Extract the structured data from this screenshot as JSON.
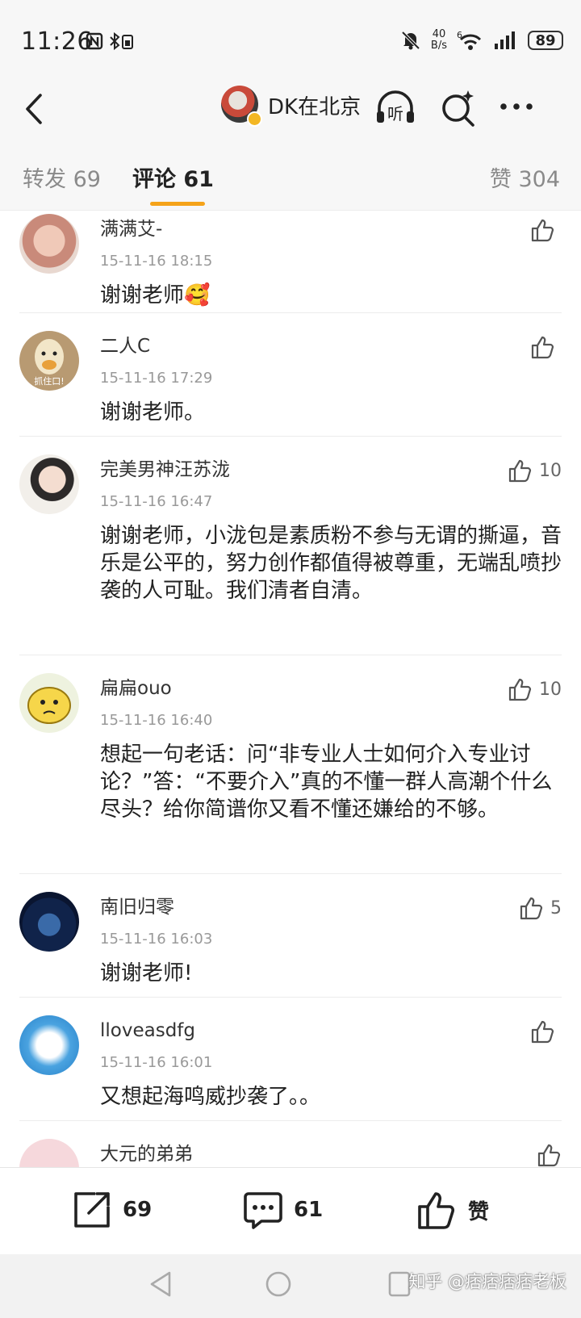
{
  "status_bar": {
    "time": "11:26",
    "net_speed_top": "40",
    "net_speed_bottom": "B/s",
    "signal_label": "6",
    "battery": "89"
  },
  "header": {
    "title": "DK在北京",
    "listen_label": "听"
  },
  "tabs": {
    "repost": "转发 69",
    "comments": "评论 61",
    "likes": "赞 304"
  },
  "comments": [
    {
      "name": "满满艾-",
      "time": "15-11-16 18:15",
      "text": "谢谢老师",
      "emoji": "🥰",
      "likes": ""
    },
    {
      "name": "二人C",
      "time": "15-11-16 17:29",
      "text": "谢谢老师。",
      "likes": ""
    },
    {
      "name": "完美男神汪苏泷",
      "time": "15-11-16 16:47",
      "text": "谢谢老师，小泷包是素质粉不参与无谓的撕逼，音乐是公平的，努力创作都值得被尊重，无端乱喷抄袭的人可耻。我们清者自清。",
      "likes": "10"
    },
    {
      "name": "扁扁ouo",
      "time": "15-11-16 16:40",
      "text": "想起一句老话：问“非专业人士如何介入专业讨论？”答：“不要介入”真的不懂一群人高潮个什么尽头？给你简谱你又看不懂还嫌给的不够。",
      "likes": "10"
    },
    {
      "name": "南旧归零",
      "time": "15-11-16 16:03",
      "text": "谢谢老师!",
      "likes": "5"
    },
    {
      "name": "lloveasdfg",
      "time": "15-11-16 16:01",
      "text": "又想起海鸣威抄袭了。。",
      "likes": ""
    },
    {
      "name": "大元的弟弟",
      "time": "",
      "text": "",
      "likes": ""
    }
  ],
  "avatar_texts": {
    "duck": "抓住口!"
  },
  "bottom_bar": {
    "repost_count": "69",
    "comment_count": "61",
    "like_label": "赞"
  },
  "watermark": "知乎 @痞痞痞痞老板",
  "colors": {
    "accent": "#f5a31a",
    "background": "#f7f7f7"
  }
}
